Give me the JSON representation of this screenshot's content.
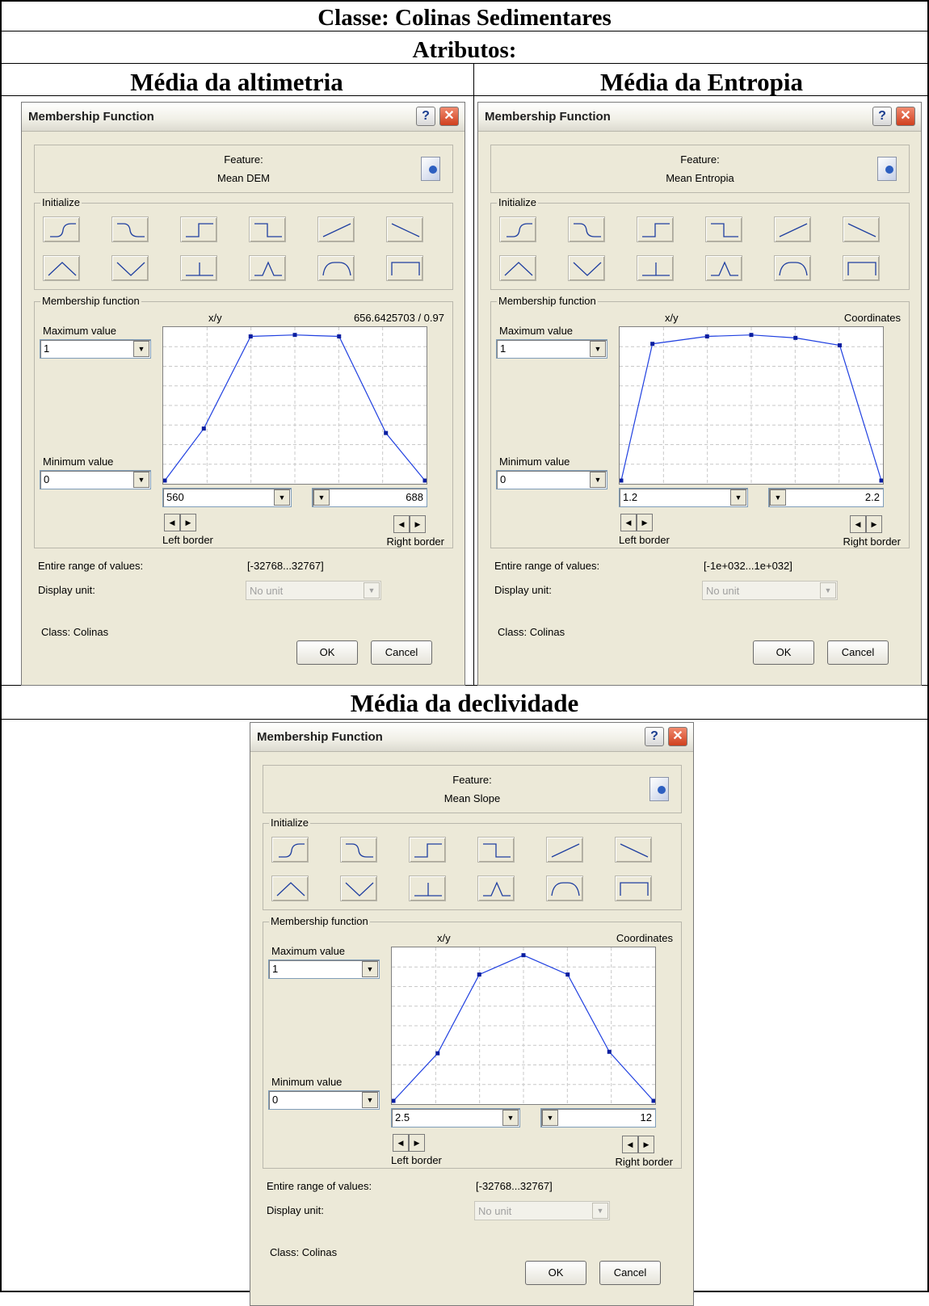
{
  "title": "Classe: Colinas Sedimentares",
  "subtitle": "Atributos:",
  "dialogs": [
    {
      "heading": "Média da altimetria",
      "window_title": "Membership Function",
      "feature_label": "Feature:",
      "feature_name": "Mean DEM",
      "initialize_label": "Initialize",
      "mf_label": "Membership function",
      "xy_label": "x/y",
      "coord_readout": "656.6425703 / 0.97",
      "max_label": "Maximum value",
      "max_value": "1",
      "min_label": "Minimum value",
      "min_value": "0",
      "left_value": "560",
      "right_value": "688",
      "left_border_label": "Left border",
      "right_border_label": "Right border",
      "range_label": "Entire range of values:",
      "range_value": "[-32768...32767]",
      "unit_label": "Display unit:",
      "unit_value": "No unit",
      "class_label": "Class: Colinas",
      "ok_label": "OK",
      "cancel_label": "Cancel",
      "curve": [
        [
          0,
          0
        ],
        [
          0.15,
          0.35
        ],
        [
          0.33,
          0.97
        ],
        [
          0.5,
          0.98
        ],
        [
          0.67,
          0.97
        ],
        [
          0.85,
          0.32
        ],
        [
          1.0,
          0
        ]
      ]
    },
    {
      "heading": "Média da Entropia",
      "window_title": "Membership Function",
      "feature_label": "Feature:",
      "feature_name": "Mean Entropia",
      "initialize_label": "Initialize",
      "mf_label": "Membership function",
      "xy_label": "x/y",
      "coord_readout": "Coordinates",
      "max_label": "Maximum value",
      "max_value": "1",
      "min_label": "Minimum value",
      "min_value": "0",
      "left_value": "1.2",
      "right_value": "2.2",
      "left_border_label": "Left border",
      "right_border_label": "Right border",
      "range_label": "Entire range of values:",
      "range_value": "[-1e+032...1e+032]",
      "unit_label": "Display unit:",
      "unit_value": "No unit",
      "class_label": "Class: Colinas",
      "ok_label": "OK",
      "cancel_label": "Cancel",
      "curve": [
        [
          0,
          0
        ],
        [
          0.12,
          0.92
        ],
        [
          0.33,
          0.97
        ],
        [
          0.5,
          0.98
        ],
        [
          0.67,
          0.96
        ],
        [
          0.84,
          0.91
        ],
        [
          1.0,
          0
        ]
      ]
    },
    {
      "heading": "Média da declividade",
      "window_title": "Membership Function",
      "feature_label": "Feature:",
      "feature_name": "Mean Slope",
      "initialize_label": "Initialize",
      "mf_label": "Membership function",
      "xy_label": "x/y",
      "coord_readout": "Coordinates",
      "max_label": "Maximum value",
      "max_value": "1",
      "min_label": "Minimum value",
      "min_value": "0",
      "left_value": "2.5",
      "right_value": "12",
      "left_border_label": "Left border",
      "right_border_label": "Right border",
      "range_label": "Entire range of values:",
      "range_value": "[-32768...32767]",
      "unit_label": "Display unit:",
      "unit_value": "No unit",
      "class_label": "Class: Colinas",
      "ok_label": "OK",
      "cancel_label": "Cancel",
      "curve": [
        [
          0,
          0
        ],
        [
          0.17,
          0.32
        ],
        [
          0.33,
          0.85
        ],
        [
          0.5,
          0.98
        ],
        [
          0.67,
          0.85
        ],
        [
          0.83,
          0.33
        ],
        [
          1.0,
          0
        ]
      ]
    }
  ],
  "init_shapes": [
    "s-rise-icon",
    "s-fall-icon",
    "step-up-icon",
    "step-down-icon",
    "linear-up-icon",
    "linear-down-icon",
    "triangle-icon",
    "v-shape-icon",
    "singleton-icon",
    "gaussian-icon",
    "trapezoid-icon",
    "rectangle-icon"
  ]
}
